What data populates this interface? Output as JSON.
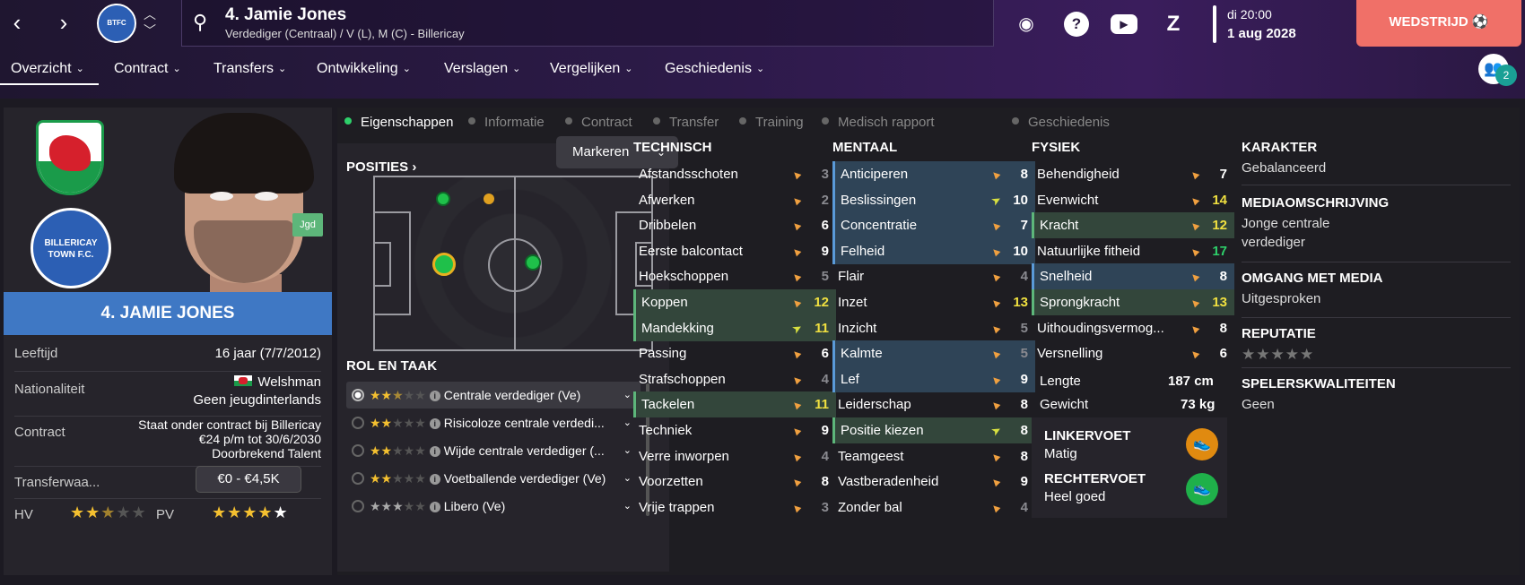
{
  "header": {
    "back_icon": "chevron-left-icon",
    "forward_icon": "chevron-right-icon",
    "club_logo_text": "BTFC",
    "player_title": "4. Jamie Jones",
    "player_subtitle": "Verdediger (Centraal) / V (L), M (C) - Billericay",
    "day_time": "di 20:00",
    "date": "1 aug 2028",
    "match_button": "WEDSTRIJD",
    "user_badge": "2"
  },
  "menu": [
    "Overzicht",
    "Contract",
    "Transfers",
    "Ontwikkeling",
    "Verslagen",
    "Vergelijken",
    "Geschiedenis"
  ],
  "profile": {
    "jgd": "Jgd",
    "name": "4. JAMIE JONES",
    "club_name": "BILLERICAY TOWN F.C.",
    "age_label": "Leeftijd",
    "age_value": "16 jaar (7/7/2012)",
    "nat_label": "Nationaliteit",
    "nat_value": "Welshman",
    "nat_sub": "Geen jeugdinterlands",
    "contract_label": "Contract",
    "contract_l1": "Staat onder contract bij Billericay",
    "contract_l2": "€24 p/m tot 30/6/2030",
    "contract_l3": "Doorbrekend Talent",
    "transfer_label": "Transferwaa...",
    "transfer_value": "€0 - €4,5K",
    "hv_label": "HV",
    "pv_label": "PV",
    "hv_stars": 2.5,
    "pv_stars": 5
  },
  "tabs": [
    "Eigenschappen",
    "Informatie",
    "Contract",
    "Transfer",
    "Training",
    "Medisch rapport",
    "Geschiedenis"
  ],
  "positions": {
    "title": "POSITIES",
    "mark_label": "Markeren",
    "role_title": "ROL EN TAAK",
    "roles": [
      {
        "label": "Centrale verdediger (Ve)",
        "stars": 2.5
      },
      {
        "label": "Risicoloze centrale verdedi...",
        "stars": 2
      },
      {
        "label": "Wijde centrale verdediger (...",
        "stars": 2
      },
      {
        "label": "Voetballende verdediger (Ve)",
        "stars": 2
      },
      {
        "label": "Libero (Ve)",
        "stars": 3
      }
    ]
  },
  "technisch": {
    "title": "TECHNISCH",
    "rows": [
      {
        "name": "Afstandsschoten",
        "val": "3"
      },
      {
        "name": "Afwerken",
        "val": "2"
      },
      {
        "name": "Dribbelen",
        "val": "6"
      },
      {
        "name": "Eerste balcontact",
        "val": "9"
      },
      {
        "name": "Hoekschoppen",
        "val": "5"
      },
      {
        "name": "Koppen",
        "val": "12"
      },
      {
        "name": "Mandekking",
        "val": "11"
      },
      {
        "name": "Passing",
        "val": "6"
      },
      {
        "name": "Strafschoppen",
        "val": "4"
      },
      {
        "name": "Tackelen",
        "val": "11"
      },
      {
        "name": "Techniek",
        "val": "9"
      },
      {
        "name": "Verre inworpen",
        "val": "4"
      },
      {
        "name": "Voorzetten",
        "val": "8"
      },
      {
        "name": "Vrije trappen",
        "val": "3"
      }
    ]
  },
  "mentaal": {
    "title": "MENTAAL",
    "rows": [
      {
        "name": "Anticiperen",
        "val": "8"
      },
      {
        "name": "Beslissingen",
        "val": "10"
      },
      {
        "name": "Concentratie",
        "val": "7"
      },
      {
        "name": "Felheid",
        "val": "10"
      },
      {
        "name": "Flair",
        "val": "4"
      },
      {
        "name": "Inzet",
        "val": "13"
      },
      {
        "name": "Inzicht",
        "val": "5"
      },
      {
        "name": "Kalmte",
        "val": "5"
      },
      {
        "name": "Lef",
        "val": "9"
      },
      {
        "name": "Leiderschap",
        "val": "8"
      },
      {
        "name": "Positie kiezen",
        "val": "8"
      },
      {
        "name": "Teamgeest",
        "val": "8"
      },
      {
        "name": "Vastberadenheid",
        "val": "9"
      },
      {
        "name": "Zonder bal",
        "val": "4"
      }
    ]
  },
  "fysiek": {
    "title": "FYSIEK",
    "rows": [
      {
        "name": "Behendigheid",
        "val": "7"
      },
      {
        "name": "Evenwicht",
        "val": "14"
      },
      {
        "name": "Kracht",
        "val": "12"
      },
      {
        "name": "Natuurlijke fitheid",
        "val": "17"
      },
      {
        "name": "Snelheid",
        "val": "8"
      },
      {
        "name": "Sprongkracht",
        "val": "13"
      },
      {
        "name": "Uithoudingsvermog...",
        "val": "8"
      },
      {
        "name": "Versnelling",
        "val": "6"
      }
    ],
    "length_label": "Lengte",
    "length_value": "187 cm",
    "weight_label": "Gewicht",
    "weight_value": "73 kg",
    "left_foot_label": "LINKERVOET",
    "left_foot_value": "Matig",
    "right_foot_label": "RECHTERVOET",
    "right_foot_value": "Heel goed"
  },
  "karakter": {
    "k1": "KARAKTER",
    "v1": "Gebalanceerd",
    "k2": "MEDIAOMSCHRIJVING",
    "v2": "Jonge centrale verdediger",
    "k3": "OMGANG MET MEDIA",
    "v3": "Uitgesproken",
    "k4": "REPUTATIE",
    "k5": "SPELERSKWALITEITEN",
    "v5": "Geen"
  },
  "colors": {
    "accent_green": "#2ed06a",
    "match_button": "#f07068",
    "name_bar": "#3f78c4"
  }
}
